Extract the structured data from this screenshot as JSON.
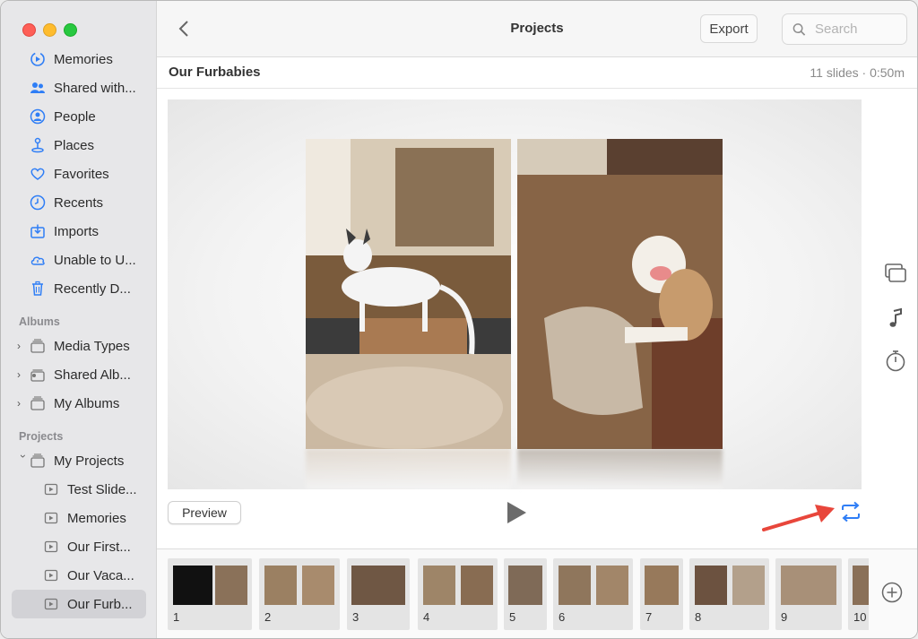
{
  "window": {
    "title": "Projects"
  },
  "sidebar": {
    "items": [
      {
        "label": "Memories",
        "icon": "memories-icon"
      },
      {
        "label": "Shared with...",
        "icon": "shared-with-you-icon"
      },
      {
        "label": "People",
        "icon": "people-icon"
      },
      {
        "label": "Places",
        "icon": "places-icon"
      },
      {
        "label": "Favorites",
        "icon": "heart-icon"
      },
      {
        "label": "Recents",
        "icon": "clock-icon"
      },
      {
        "label": "Imports",
        "icon": "import-icon"
      },
      {
        "label": "Unable to U...",
        "icon": "cloud-icon"
      },
      {
        "label": "Recently D...",
        "icon": "trash-icon"
      }
    ],
    "albums_header": "Albums",
    "albums": [
      {
        "label": "Media Types"
      },
      {
        "label": "Shared Alb..."
      },
      {
        "label": "My Albums"
      }
    ],
    "projects_header": "Projects",
    "my_projects": "My Projects",
    "projects": [
      {
        "label": "Test Slide..."
      },
      {
        "label": "Memories"
      },
      {
        "label": "Our First..."
      },
      {
        "label": "Our Vaca..."
      },
      {
        "label": "Our Furb...",
        "selected": true
      }
    ]
  },
  "toolbar": {
    "title": "Projects",
    "export_label": "Export",
    "search_placeholder": "Search"
  },
  "project": {
    "name": "Our Furbabies",
    "meta": "11 slides · 0:50m"
  },
  "controls": {
    "preview_label": "Preview"
  },
  "filmstrip": {
    "slides": [
      "1",
      "2",
      "3",
      "4",
      "5",
      "6",
      "7",
      "8",
      "9",
      "10"
    ]
  },
  "colors": {
    "accent": "#2f7ef6",
    "annotation_arrow": "#e8463b"
  }
}
